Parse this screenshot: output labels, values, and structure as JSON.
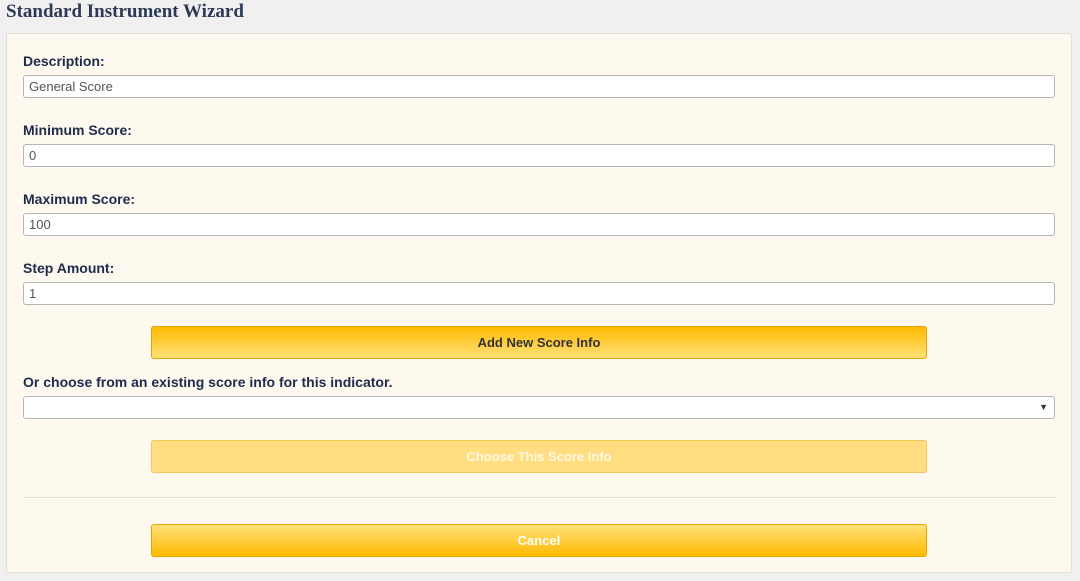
{
  "page": {
    "title": "Standard Instrument Wizard"
  },
  "form": {
    "description": {
      "label": "Description:",
      "value": "General Score"
    },
    "minimum": {
      "label": "Minimum Score:",
      "value": "0"
    },
    "maximum": {
      "label": "Maximum Score:",
      "value": "100"
    },
    "step": {
      "label": "Step Amount:",
      "value": "1"
    },
    "add_button": "Add New Score Info",
    "existing_label": "Or choose from an existing score info for this indicator.",
    "existing_select_value": "",
    "choose_button": "Choose This Score Info",
    "cancel_button": "Cancel"
  }
}
